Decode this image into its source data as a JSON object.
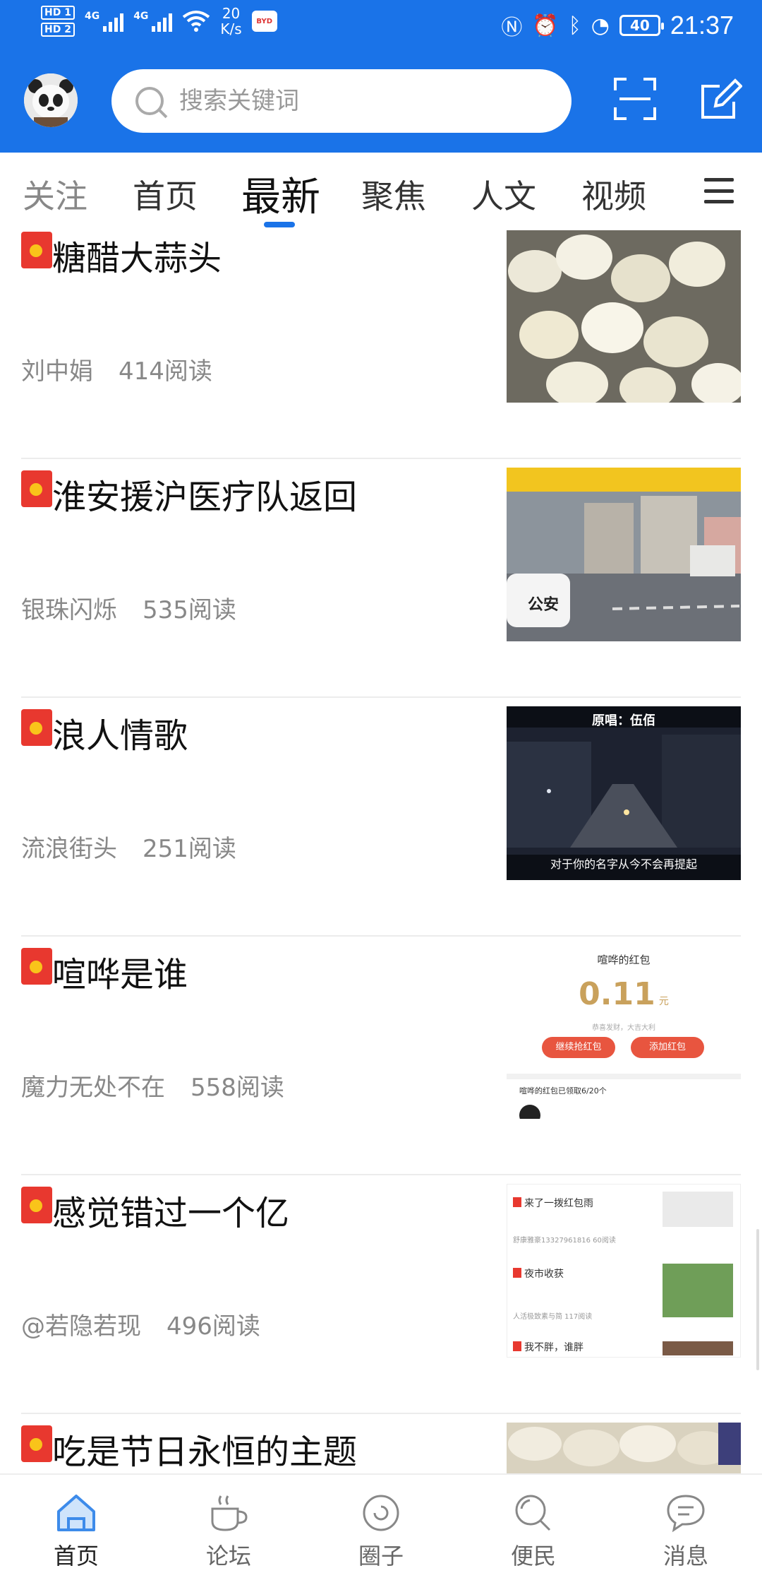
{
  "status_bar": {
    "hd1": "HD 1",
    "hd2": "HD 2",
    "net1": "4G",
    "net2": "4G",
    "speed_value": "20",
    "speed_unit": "K/s",
    "battery": "40",
    "time": "21:37"
  },
  "header": {
    "search_placeholder": "搜索关键词",
    "brand_color": "#1a73e8"
  },
  "tabs": [
    {
      "label": "关注",
      "active": false
    },
    {
      "label": "首页",
      "active": false
    },
    {
      "label": "最新",
      "active": true
    },
    {
      "label": "聚焦",
      "active": false
    },
    {
      "label": "人文",
      "active": false
    },
    {
      "label": "视频",
      "active": false
    }
  ],
  "feed": [
    {
      "title": "糖醋大蒜头",
      "author": "刘中娟",
      "reads": "414阅读"
    },
    {
      "title": "淮安援沪医疗队返回",
      "author": "银珠闪烁",
      "reads": "535阅读",
      "thumb_caption": "公安"
    },
    {
      "title": "浪人情歌",
      "author": "流浪街头",
      "reads": "251阅读",
      "thumb_top": "原唱：伍佰",
      "thumb_bottom": "对于你的名字从今不会再提起"
    },
    {
      "title": "喧哗是谁",
      "author": "魔力无处不在",
      "reads": "558阅读",
      "thumb": {
        "heading": "喧哗的红包",
        "amount": "0.11",
        "unit": "元",
        "blessing": "恭喜发财，大吉大利",
        "btn1": "继续抢红包",
        "btn2": "添加红包",
        "footer": "喧哗的红包已领取6/20个"
      }
    },
    {
      "title": "感觉错过一个亿",
      "author": "@若隐若现",
      "reads": "496阅读",
      "thumb": {
        "item1": "来了一拨红包雨",
        "meta1": "舒康雅豪13327961816  60阅读",
        "item2": "夜市收获",
        "meta2": "人活极致素与简  117阅读",
        "item3": "我不胖，谁胖"
      }
    },
    {
      "title": "吃是节日永恒的主题"
    }
  ],
  "bottom_nav": [
    {
      "label": "首页",
      "icon": "home-icon",
      "active": true
    },
    {
      "label": "论坛",
      "icon": "cup-icon",
      "active": false
    },
    {
      "label": "圈子",
      "icon": "circle-icon",
      "active": false
    },
    {
      "label": "便民",
      "icon": "search-icon",
      "active": false
    },
    {
      "label": "消息",
      "icon": "chat-icon",
      "active": false
    }
  ]
}
